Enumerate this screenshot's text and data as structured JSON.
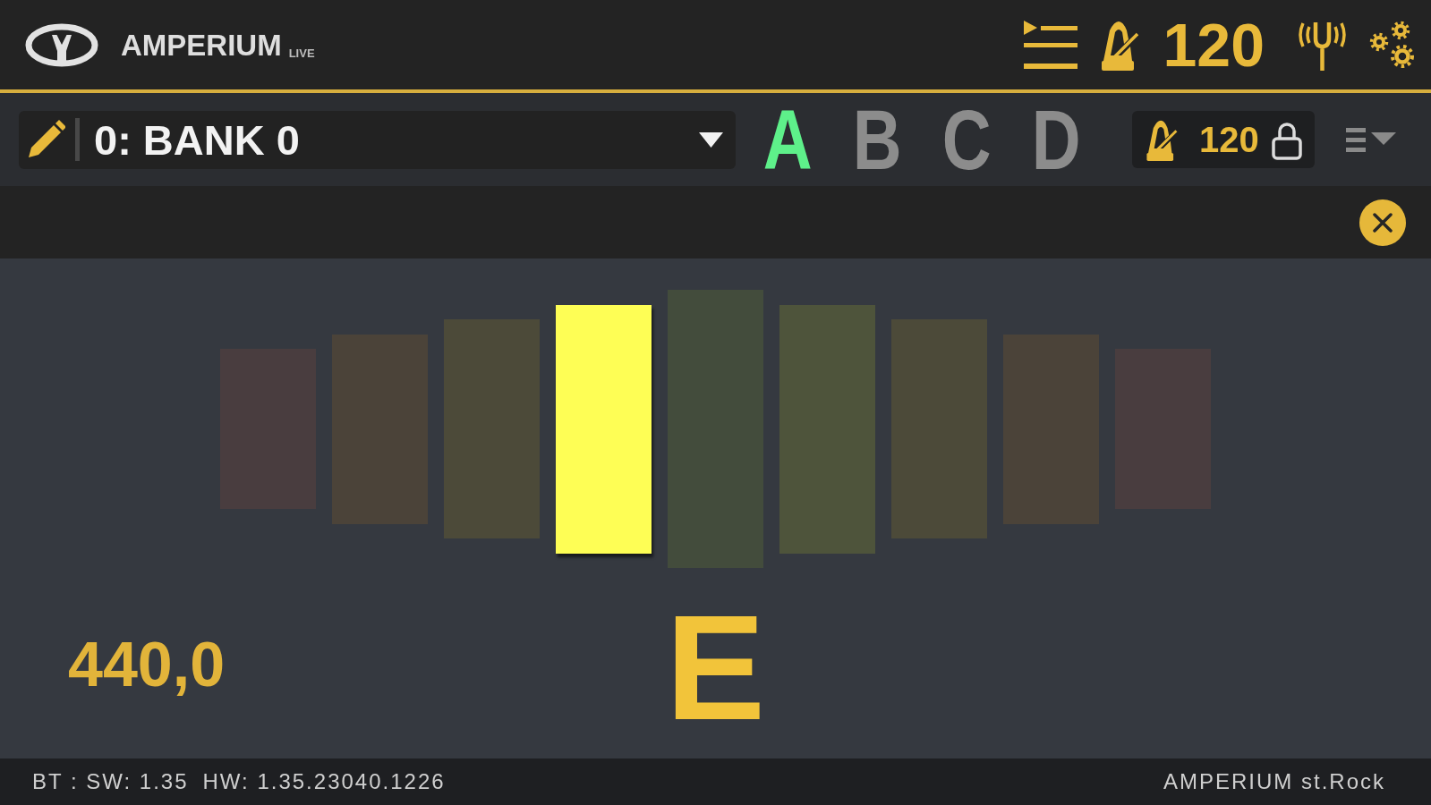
{
  "header": {
    "logo": {
      "title": "AMPERIUM",
      "subtitle": "LIVE"
    },
    "tempo": "120"
  },
  "toolbar": {
    "bank": {
      "value": "0: BANK 0"
    },
    "presets": [
      {
        "label": "A",
        "selected": true
      },
      {
        "label": "B",
        "selected": false
      },
      {
        "label": "C",
        "selected": false
      },
      {
        "label": "D",
        "selected": false
      }
    ],
    "tempo": {
      "value": "120",
      "locked": true
    }
  },
  "tuner": {
    "segments": [
      {
        "color": "#493d3f",
        "lit": false
      },
      {
        "color": "#4b4339",
        "lit": false
      },
      {
        "color": "#4c4a39",
        "lit": false
      },
      {
        "color": "#fefe55",
        "lit": true
      },
      {
        "color": "#434c3c",
        "lit": false
      },
      {
        "color": "#4e543b",
        "lit": false
      },
      {
        "color": "#4c4a39",
        "lit": false
      },
      {
        "color": "#4b4339",
        "lit": false
      },
      {
        "color": "#493d3f",
        "lit": false
      }
    ],
    "note": "E",
    "reference": "440,0"
  },
  "status_bar": {
    "left": [
      "BT : SW: 1.35",
      "HW: 1.35.23040.1226"
    ],
    "right": [
      "AMPERIUM st.Rock"
    ]
  }
}
